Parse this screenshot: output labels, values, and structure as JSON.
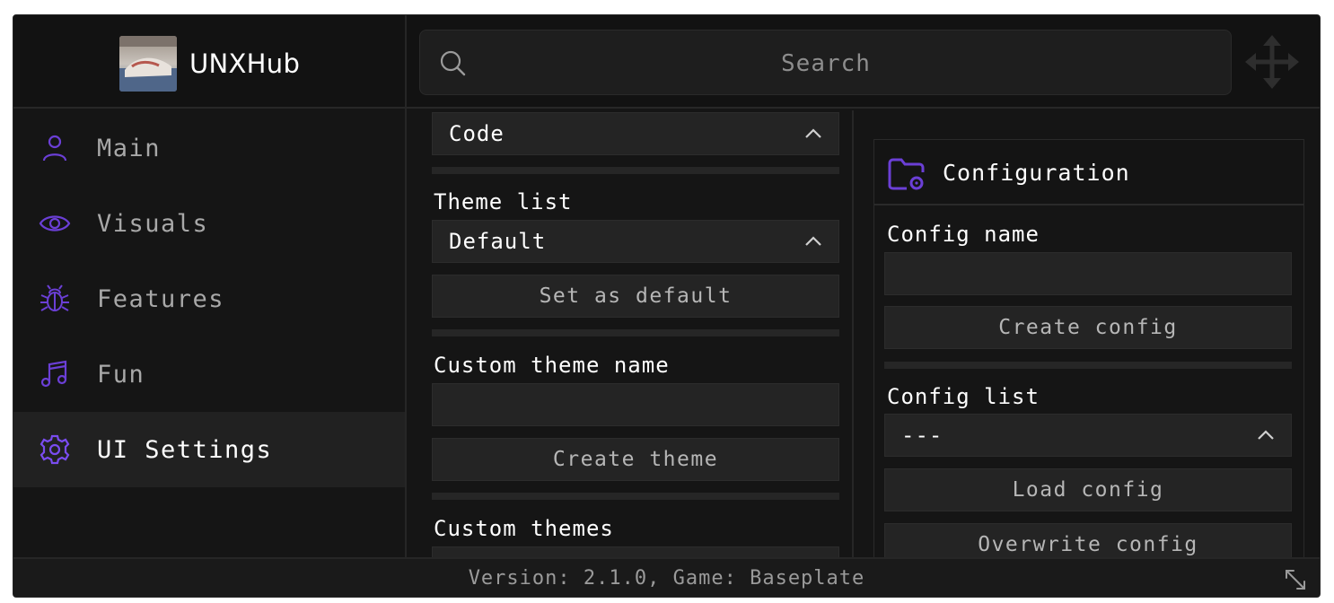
{
  "app": {
    "name": "UNXHub",
    "accent": "#6b3fd6"
  },
  "search": {
    "placeholder": "Search"
  },
  "sidebar": {
    "items": [
      {
        "label": "Main",
        "icon": "user-icon",
        "active": false
      },
      {
        "label": "Visuals",
        "icon": "eye-icon",
        "active": false
      },
      {
        "label": "Features",
        "icon": "bug-icon",
        "active": false
      },
      {
        "label": "Fun",
        "icon": "music-note-icon",
        "active": false
      },
      {
        "label": "UI Settings",
        "icon": "gear-icon",
        "active": true
      }
    ]
  },
  "theme_panel": {
    "font_dropdown": {
      "value": "Code"
    },
    "theme_list_label": "Theme list",
    "theme_list_dropdown": {
      "value": "Default"
    },
    "set_default_button": "Set as default",
    "custom_theme_name_label": "Custom theme name",
    "custom_theme_name_input": {
      "value": "",
      "placeholder": ""
    },
    "create_theme_button": "Create theme",
    "custom_themes_label": "Custom themes"
  },
  "config_panel": {
    "title": "Configuration",
    "config_name_label": "Config name",
    "config_name_input": {
      "value": "",
      "placeholder": ""
    },
    "create_config_button": "Create config",
    "config_list_label": "Config list",
    "config_list_dropdown": {
      "value": "---"
    },
    "load_config_button": "Load config",
    "overwrite_config_button": "Overwrite config"
  },
  "footer": {
    "version_text": "Version: 2.1.0, Game: Baseplate"
  }
}
